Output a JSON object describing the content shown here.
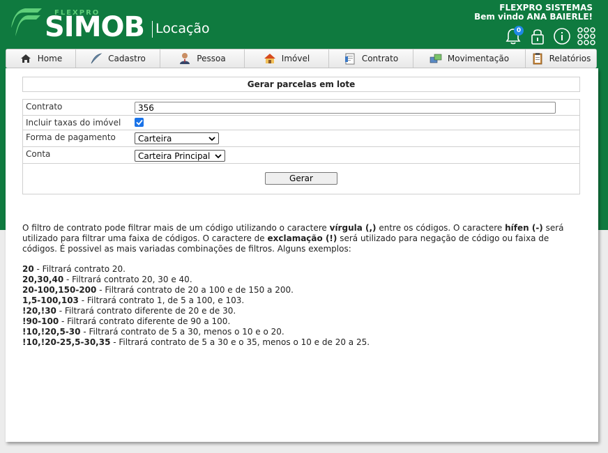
{
  "brand": {
    "flexpro": "FLEXPRO",
    "name": "SIMOB",
    "module": "Locação",
    "logo_color": "#5fcf7a"
  },
  "user": {
    "company": "FLEXPRO SISTEMAS",
    "welcome": "Bem vindo ANA BAIERLE!"
  },
  "header_icons": {
    "notifications": {
      "icon": "bell-icon",
      "count": "0"
    },
    "lock": {
      "icon": "lock-icon"
    },
    "info": {
      "icon": "info-icon"
    },
    "apps": {
      "icon": "apps-grid-icon"
    }
  },
  "nav": {
    "home": "Home",
    "cadastro": "Cadastro",
    "pessoa": "Pessoa",
    "imovel": "Imóvel",
    "contrato": "Contrato",
    "movimentacao": "Movimentação",
    "relatorios": "Relatórios"
  },
  "form": {
    "title": "Gerar parcelas em lote",
    "contrato_label": "Contrato",
    "contrato_value": "356",
    "taxas_label": "Incluir taxas do imóvel",
    "forma_label": "Forma de pagamento",
    "forma_value": "Carteira",
    "conta_label": "Conta",
    "conta_value": "Carteira Principal",
    "gerar_label": "Gerar"
  },
  "help": {
    "p1": "O filtro de contrato pode filtrar mais de um código utilizando o caractere ",
    "b1": "vírgula (,)",
    "p2": " entre os códigos. O caractere ",
    "b2": "hífen (-)",
    "p3": " será utilizado para filtrar uma faixa de códigos. O caractere de ",
    "b3": "exclamação (!)",
    "p4": " será utilizado para negação de código ou faixa de códigos. É possivel as mais variadas combinações de filtros. Alguns exemplos:",
    "examples": [
      {
        "code": "20",
        "desc": " - Filtrará contrato 20."
      },
      {
        "code": "20,30,40",
        "desc": " - Filtrará contrato 20, 30 e 40."
      },
      {
        "code": "20-100,150-200",
        "desc": " - Filtrará contrato de 20 a 100 e de 150 a 200."
      },
      {
        "code": "1,5-100,103",
        "desc": " - Filtrará contrato 1, de 5 a 100, e 103."
      },
      {
        "code": "!20,!30",
        "desc": " - Filtrará contrato diferente de 20 e de 30."
      },
      {
        "code": "!90-100",
        "desc": " - Filtrará contrato diferente de 90 a 100."
      },
      {
        "code": "!10,!20,5-30",
        "desc": " - Filtrará contrato de 5 a 30, menos o 10 e o 20."
      },
      {
        "code": "!10,!20-25,5-30,35",
        "desc": " - Filtrará contrato de 5 a 30 e o 35, menos o 10 e de 20 a 25."
      }
    ]
  },
  "colors": {
    "header_green": "#0f7a3f",
    "checkbox_blue": "#1a73e8",
    "badge_blue": "#1e88e5"
  }
}
